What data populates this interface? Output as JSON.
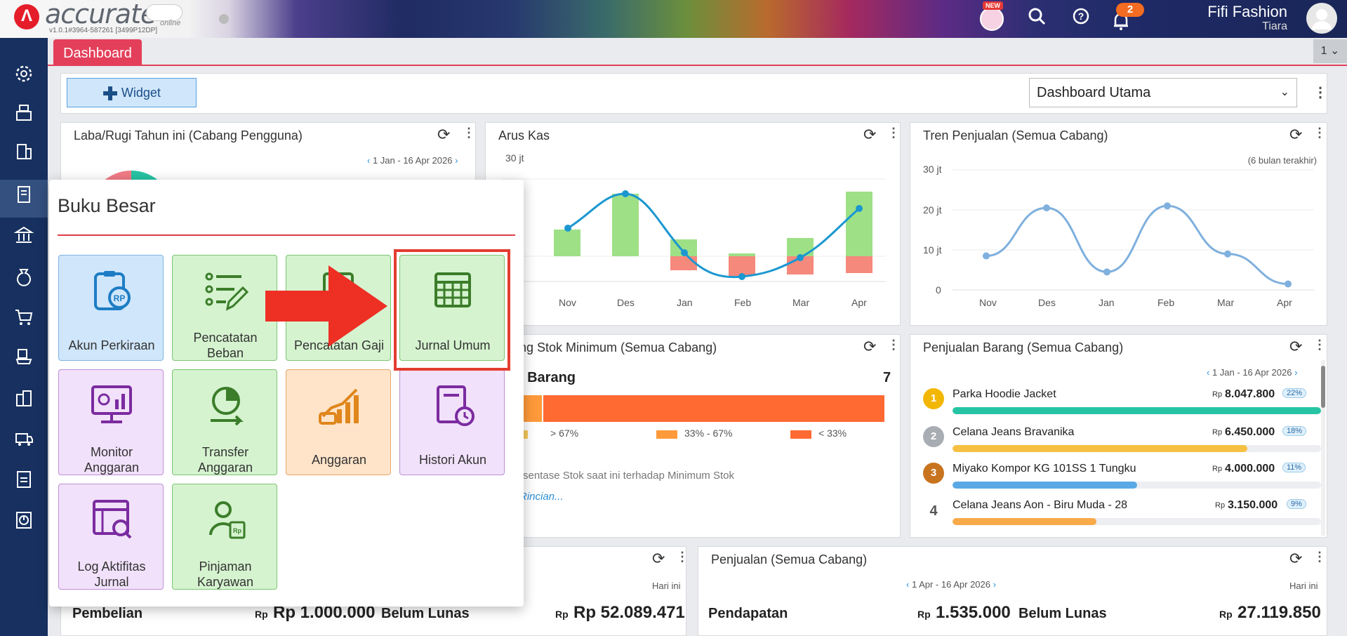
{
  "app": {
    "brand": "accurate",
    "brand_sub": "online",
    "version": "v1.0.1#3964-587261 [3499P12DP]",
    "new_badge": "NEW",
    "notif_count": "2",
    "user_name": "Fifi Fashion",
    "user_sub": "Tiara"
  },
  "tab": {
    "label": "Dashboard",
    "count": "1"
  },
  "toolbar": {
    "widget_label": "Widget",
    "dashboard_select": "Dashboard Utama"
  },
  "laba": {
    "title": "Laba/Rugi Tahun ini (Cabang Pengguna)",
    "range": "1 Jan - 16 Apr 2026"
  },
  "arus": {
    "title": "Arus Kas",
    "chart_data": {
      "type": "bar",
      "categories": [
        "Nov",
        "Des",
        "Jan",
        "Feb",
        "Mar",
        "Apr"
      ],
      "y_tick_top": "30 jt",
      "series": []
    }
  },
  "tren": {
    "title": "Tren Penjualan (Semua Cabang)",
    "note": "(6 bulan terakhir)",
    "chart_data": {
      "type": "line",
      "categories": [
        "Nov",
        "Des",
        "Jan",
        "Feb",
        "Mar",
        "Apr"
      ],
      "y_ticks": [
        "30 jt",
        "20 jt",
        "10 jt",
        "0"
      ],
      "ylim": [
        0,
        30
      ],
      "values": [
        8.5,
        20.5,
        4.5,
        21,
        9,
        1.5
      ]
    }
  },
  "stok": {
    "title": "ng Stok Minimum (Semua Cabang)",
    "label": "l Barang",
    "count": "7",
    "legend": [
      "> 67%",
      "33% - 67%",
      "< 33%"
    ],
    "note": "rsentase Stok saat ini terhadap Minimum Stok",
    "link": "Rincian..."
  },
  "penjualan_barang": {
    "title": "Penjualan Barang (Semua Cabang)",
    "range": "1 Jan - 16 Apr 2026",
    "items": [
      {
        "rank": "1",
        "name": "Parka Hoodie Jacket",
        "rp": "Rp",
        "value": "8.047.800",
        "pct": "22%",
        "fill": 1.0,
        "color": "#26c4a4"
      },
      {
        "rank": "2",
        "name": "Celana Jeans Bravanika",
        "rp": "Rp",
        "value": "6.450.000",
        "pct": "18%",
        "fill": 0.8,
        "color": "#f6c042"
      },
      {
        "rank": "3",
        "name": "Miyako Kompor KG 101SS 1 Tungku",
        "rp": "Rp",
        "value": "4.000.000",
        "pct": "11%",
        "fill": 0.5,
        "color": "#5aa9e6"
      },
      {
        "rank": "4",
        "name": "Celana Jeans Aon - Biru Muda - 28",
        "rp": "Rp",
        "value": "3.150.000",
        "pct": "9%",
        "fill": 0.39,
        "color": "#f8a948"
      }
    ]
  },
  "pembelian": {
    "note": "Hari ini",
    "label1": "Pembelian",
    "rp1": "Rp",
    "value1": "Rp 1.000.000",
    "label2": "Belum Lunas",
    "rp2": "Rp",
    "value2": "Rp 52.089.471"
  },
  "penjualan": {
    "title": "Penjualan (Semua Cabang)",
    "range": "1 Apr - 16 Apr 2026",
    "note": "Hari ini",
    "label1": "Pendapatan",
    "rp1": "Rp",
    "value1": "1.535.000",
    "label2": "Belum Lunas",
    "rp2": "Rp",
    "value2": "27.119.850"
  },
  "popup": {
    "title": "Buku Besar",
    "tiles": [
      {
        "line1": "Akun Perkiraan",
        "line2": ""
      },
      {
        "line1": "Pencatatan",
        "line2": "Beban"
      },
      {
        "line1": "Pencatatan Gaji",
        "line2": ""
      },
      {
        "line1": "Jurnal Umum",
        "line2": ""
      },
      {
        "line1": "Monitor",
        "line2": "Anggaran"
      },
      {
        "line1": "Transfer",
        "line2": "Anggaran"
      },
      {
        "line1": "Anggaran",
        "line2": ""
      },
      {
        "line1": "Histori Akun",
        "line2": ""
      },
      {
        "line1": "Log Aktifitas",
        "line2": "Jurnal"
      },
      {
        "line1": "Pinjaman",
        "line2": "Karyawan"
      }
    ]
  }
}
